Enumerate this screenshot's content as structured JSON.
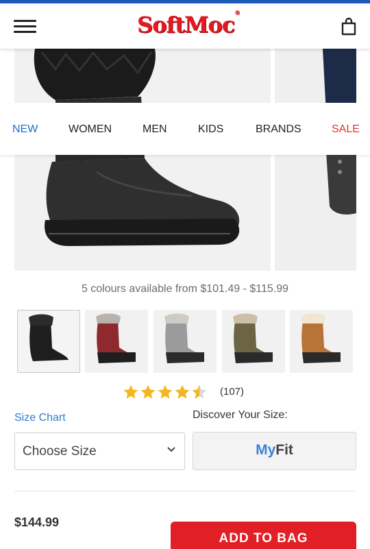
{
  "header": {
    "logo_text": "SoftMoc",
    "menu_icon": "hamburger-menu-icon",
    "bag_icon": "shopping-bag-icon"
  },
  "nav": {
    "items": [
      "NEW",
      "WOMEN",
      "MEN",
      "KIDS",
      "BRANDS",
      "SALE"
    ],
    "highlight_color": "#1e6fc7",
    "sale_color": "#e0342f"
  },
  "product": {
    "colours_text": "5 colours available from $101.49 - $115.99",
    "swatch_colors": [
      "black",
      "red",
      "grey",
      "olive",
      "tan"
    ],
    "rating": {
      "stars": 4.5,
      "count_text": "(107)"
    },
    "price": "$144.99"
  },
  "sizing": {
    "size_chart_label": "Size Chart",
    "discover_label": "Discover Your Size:",
    "select_label": "Choose Size",
    "myfit_my": "My",
    "myfit_fit": "Fit"
  },
  "cta": {
    "add_to_bag": "ADD TO BAG"
  },
  "colors": {
    "brand_red": "#e01f26",
    "link_blue": "#2f7ad1",
    "top_bar": "#1e5bb8"
  }
}
